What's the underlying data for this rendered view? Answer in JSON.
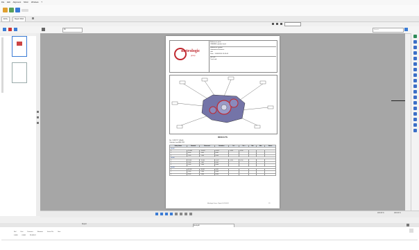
{
  "menubar": {
    "items": [
      "File",
      "Edit",
      "Alignment",
      "Mirror",
      "Windows",
      "?"
    ]
  },
  "titlebar": {
    "tabs": [
      "Entity",
      "Report Mold"
    ]
  },
  "toolbar": {
    "zoom": "Fit",
    "search_placeholder": "Search"
  },
  "report": {
    "logo_name": "metrologic",
    "logo_sub": "group",
    "ref_parts_label": "Reference parts",
    "ref_parts_value": "VMBNB3 cylinder head",
    "ref_system_label": "Reference system",
    "ref_system_value": "Geometrical features",
    "lab_label": "Lab",
    "date_label": "Date",
    "date_value": "11/09/2020 15:35:51",
    "ref_item1": "Ref cell",
    "ref_item2": "Trash tab",
    "results_title": "RESULTS",
    "results_sub1": "No. 1 ENTITY (Mold)",
    "results_sub2": "Cylinder head A3LD59",
    "table_headers": [
      "Entity Name",
      "Nominal",
      "Measured",
      "Deviation",
      "Tol -",
      "Tol +",
      "Min",
      "Max",
      "Status"
    ],
    "groups": [
      {
        "name": "MEAS1",
        "rows": [
          [
            "X",
            "-10.000",
            "-10.003",
            "-0.003",
            "-0.050",
            "0.050"
          ],
          [
            "Y",
            "3.500",
            "3.501",
            "0.001",
            "",
            ""
          ],
          [
            "Z",
            "1.000",
            "1.000",
            "0.000",
            "",
            ""
          ]
        ]
      },
      {
        "name": "MEAS2",
        "rows": [
          [
            "X",
            "26.666",
            "26.664",
            "-0.002",
            "-0.050",
            "0.050"
          ],
          [
            "Y",
            "1.000",
            "1.001",
            "0.001",
            "",
            ""
          ],
          [
            "Z",
            "5.000",
            "5.000",
            "0.000",
            "",
            ""
          ]
        ]
      },
      {
        "name": "MEAS3",
        "rows": [
          [
            "X",
            "40.000",
            "40.001",
            "0.001",
            "",
            ""
          ],
          [
            "Y",
            "2.000",
            "2.000",
            "0.000",
            "",
            ""
          ],
          [
            "Z",
            "3.000",
            "3.000",
            "0.000",
            "",
            ""
          ]
        ]
      }
    ],
    "footer_left": "Metrologic Group - Report 0.0.26.0001",
    "footer_right": "1/1"
  },
  "status": {
    "zoom1": "100.00 %",
    "zoom2": "100.00 %"
  },
  "bottom": {
    "left_label": "Report",
    "mid_label": "Modify All",
    "cols": [
      "Ref",
      "Unit",
      "Distance",
      "Rotation",
      "Scale Pts",
      "Stat"
    ],
    "row1": [
      "0.000",
      "0.000",
      "",
      "25.005 X",
      "",
      ""
    ]
  }
}
